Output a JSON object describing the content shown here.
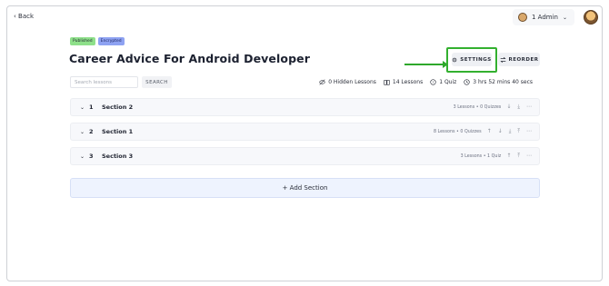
{
  "nav": {
    "back_label": "‹ Back",
    "admin_label": "1 Admin"
  },
  "course": {
    "badges": [
      "Published",
      "Encrypted"
    ],
    "title": "Career Advice For Android Developer"
  },
  "actions": {
    "settings_label": "SETTINGS",
    "reorder_label": "REORDER"
  },
  "search": {
    "placeholder": "Search lessons",
    "button_label": "SEARCH"
  },
  "stats": {
    "hidden": "0 Hidden Lessons",
    "lessons": "14 Lessons",
    "quiz": "1 Quiz",
    "duration": "3 hrs 52 mins 40 secs"
  },
  "sections": [
    {
      "num": "1",
      "name": "Section 2",
      "meta": "3 Lessons • 0 Quizzes"
    },
    {
      "num": "2",
      "name": "Section 1",
      "meta": "8 Lessons • 0 Quizzes"
    },
    {
      "num": "3",
      "name": "Section 3",
      "meta": "3 Lessons • 1 Quiz"
    }
  ],
  "add_section_label": "+ Add Section",
  "colors": {
    "published": "#8ee08a",
    "encrypted": "#8ea2f2",
    "highlight": "#33b02f",
    "add_section_bg": "#eef3fe"
  },
  "icons": [
    "chevron-left-icon",
    "chevron-down-icon",
    "gear-icon",
    "reorder-icon",
    "eye-off-icon",
    "book-icon",
    "help-circle-icon",
    "clock-icon",
    "arrow-up-icon",
    "arrow-down-icon",
    "move-bottom-icon",
    "move-top-icon",
    "more-icon"
  ]
}
